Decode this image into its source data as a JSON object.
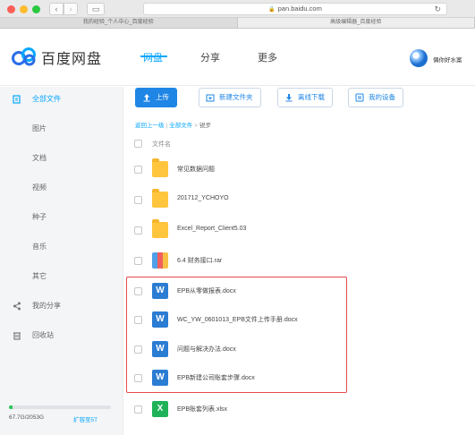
{
  "browser": {
    "url": "pan.baidu.com",
    "tabs": [
      "我的经验_个人中心_百度经验",
      "高级编辑器_百度经验"
    ]
  },
  "header": {
    "brand": "百度网盘",
    "nav": [
      "网盘",
      "分享",
      "更多"
    ],
    "username": "偶你好水案"
  },
  "sidebar": {
    "items": [
      {
        "label": "全部文件",
        "icon": "files-icon"
      },
      {
        "label": "图片"
      },
      {
        "label": "文档"
      },
      {
        "label": "视频"
      },
      {
        "label": "种子"
      },
      {
        "label": "音乐"
      },
      {
        "label": "其它"
      },
      {
        "label": "我的分享",
        "icon": "share-icon"
      },
      {
        "label": "回收站",
        "icon": "trash-icon"
      }
    ],
    "storage": {
      "text": "67.7G/2053G",
      "used_fraction": 0.033,
      "expand_label": "扩容至5T"
    }
  },
  "toolbar": {
    "upload": "上传",
    "new_folder": "新建文件夹",
    "offline_download": "离线下载",
    "my_devices": "我的设备"
  },
  "breadcrumb": {
    "back": "返回上一级",
    "all_files": "全部文件",
    "current": "锐步"
  },
  "list": {
    "header": "文件名",
    "files": [
      {
        "name": "常见数据问题",
        "type": "folder"
      },
      {
        "name": "201712_YCHOYO",
        "type": "folder"
      },
      {
        "name": "Excel_Report_Client5.03",
        "type": "folder"
      },
      {
        "name": "6.4 财务接口.rar",
        "type": "rar"
      },
      {
        "name": "EPB从零做报表.docx",
        "type": "word"
      },
      {
        "name": "WC_YW_0601013_EPB文件上传手册.docx",
        "type": "word"
      },
      {
        "name": "问题与解决办法.docx",
        "type": "word"
      },
      {
        "name": "EPB新建公司账套步骤.docx",
        "type": "word"
      },
      {
        "name": "EPB账套列表.xlsx",
        "type": "excel"
      }
    ]
  },
  "colors": {
    "accent": "#06a7ff",
    "highlight": "#e84a4a"
  }
}
